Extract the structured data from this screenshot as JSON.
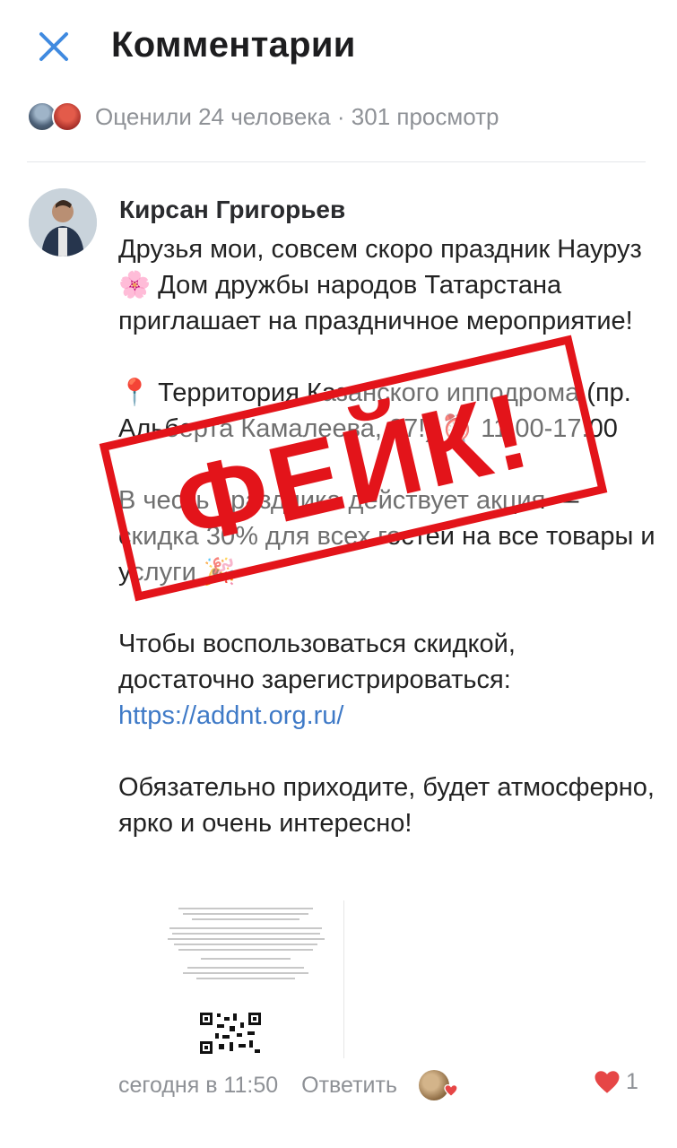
{
  "header": {
    "title": "Комментарии",
    "close_icon": "close-icon"
  },
  "likes": {
    "text": "Оценили 24 человека · 301 просмотр"
  },
  "comment": {
    "author": "Кирсан Григорьев",
    "paragraphs": [
      "Друзья мои, совсем скоро праздник Науруз 🌸 Дом дружбы народов Татарстана приглашает на праздничное мероприятие!",
      "📍 Территория Казанского ипподрома (пр. Альберта Камалеева, 27!) ⏰ 11:00-17:00",
      "В честь праздника действует акция — скидка 30% для всех гостей на все товары и услуги 🎉"
    ],
    "register_text": "Чтобы воспользоваться скидкой, достаточно зарегистрироваться:",
    "link": "https://addnt.org.ru/",
    "closing": "Обязательно приходите, будет атмосферно, ярко и очень интересно!",
    "time": "сегодня в 11:50",
    "reply_label": "Ответить",
    "like_count": "1"
  },
  "stamp": {
    "text": "ФЕЙК!",
    "color": "#e3141a"
  },
  "colors": {
    "link": "#3f7ac7",
    "accent": "#3f8ae0",
    "like": "#e64646",
    "muted": "#8e9196"
  }
}
